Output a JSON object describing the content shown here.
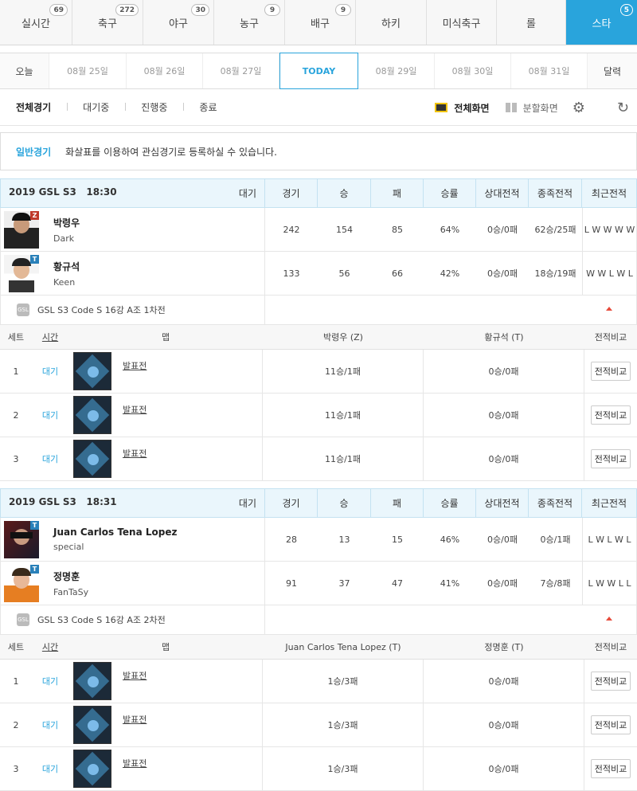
{
  "sport_tabs": [
    {
      "label": "실시간",
      "count": "69"
    },
    {
      "label": "축구",
      "count": "272"
    },
    {
      "label": "야구",
      "count": "30"
    },
    {
      "label": "농구",
      "count": "9"
    },
    {
      "label": "배구",
      "count": "9"
    },
    {
      "label": "하키",
      "count": ""
    },
    {
      "label": "미식축구",
      "count": ""
    },
    {
      "label": "롤",
      "count": ""
    },
    {
      "label": "스타",
      "count": "5"
    }
  ],
  "dates": [
    "오늘",
    "08월 25일",
    "08월 26일",
    "08월 27일",
    "TODAY",
    "08월 29일",
    "08월 30일",
    "08월 31일",
    "달력"
  ],
  "filters": {
    "all": "전체경기",
    "waiting": "대기중",
    "live": "진행중",
    "ended": "종료",
    "full_screen": "전체화면",
    "split_screen": "분할화면"
  },
  "notice": {
    "title": "일반경기",
    "text": "화살표를 이용하여 관심경기로 등록하실 수 있습니다."
  },
  "columns": {
    "games": "경기",
    "wins": "승",
    "losses": "패",
    "rate": "승률",
    "h2h": "상대전적",
    "race_rec": "종족전적",
    "recent": "최근전적"
  },
  "set_columns": {
    "set": "세트",
    "time": "시간",
    "map": "맵",
    "compare": "전적비교"
  },
  "matches": [
    {
      "title": "2019 GSL S3   18:30",
      "status": "대기",
      "players": [
        {
          "name": "박령우",
          "handle": "Dark",
          "race": "Z",
          "games": "242",
          "wins": "154",
          "losses": "85",
          "rate": "64%",
          "h2h": "0승/0패",
          "race_rec": "62승/25패",
          "recent": "L W W W W"
        },
        {
          "name": "황규석",
          "handle": "Keen",
          "race": "T",
          "games": "133",
          "wins": "56",
          "losses": "66",
          "rate": "42%",
          "h2h": "0승/0패",
          "race_rec": "18승/19패",
          "recent": "W W L W L"
        }
      ],
      "code": "GSL S3 Code S 16강 A조 1차전",
      "p1_col": "박령우 (Z)",
      "p2_col": "황규석 (T)",
      "sets": [
        {
          "num": "1",
          "time": "대기",
          "map": "발표전",
          "p1": "11승/1패",
          "p2": "0승/0패",
          "btn": "전적비교"
        },
        {
          "num": "2",
          "time": "대기",
          "map": "발표전",
          "p1": "11승/1패",
          "p2": "0승/0패",
          "btn": "전적비교"
        },
        {
          "num": "3",
          "time": "대기",
          "map": "발표전",
          "p1": "11승/1패",
          "p2": "0승/0패",
          "btn": "전적비교"
        }
      ]
    },
    {
      "title": "2019 GSL S3   18:31",
      "status": "대기",
      "players": [
        {
          "name": "Juan Carlos Tena Lopez",
          "handle": "special",
          "race": "T",
          "games": "28",
          "wins": "13",
          "losses": "15",
          "rate": "46%",
          "h2h": "0승/0패",
          "race_rec": "0승/1패",
          "recent": "L W L W L"
        },
        {
          "name": "정명훈",
          "handle": "FanTaSy",
          "race": "T",
          "games": "91",
          "wins": "37",
          "losses": "47",
          "rate": "41%",
          "h2h": "0승/0패",
          "race_rec": "7승/8패",
          "recent": "L W W L L"
        }
      ],
      "code": "GSL S3 Code S 16강 A조 2차전",
      "p1_col": "Juan Carlos Tena Lopez (T)",
      "p2_col": "정명훈 (T)",
      "sets": [
        {
          "num": "1",
          "time": "대기",
          "map": "발표전",
          "p1": "1승/3패",
          "p2": "0승/0패",
          "btn": "전적비교"
        },
        {
          "num": "2",
          "time": "대기",
          "map": "발표전",
          "p1": "1승/3패",
          "p2": "0승/0패",
          "btn": "전적비교"
        },
        {
          "num": "3",
          "time": "대기",
          "map": "발표전",
          "p1": "1승/3패",
          "p2": "0승/0패",
          "btn": "전적비교"
        }
      ]
    }
  ]
}
